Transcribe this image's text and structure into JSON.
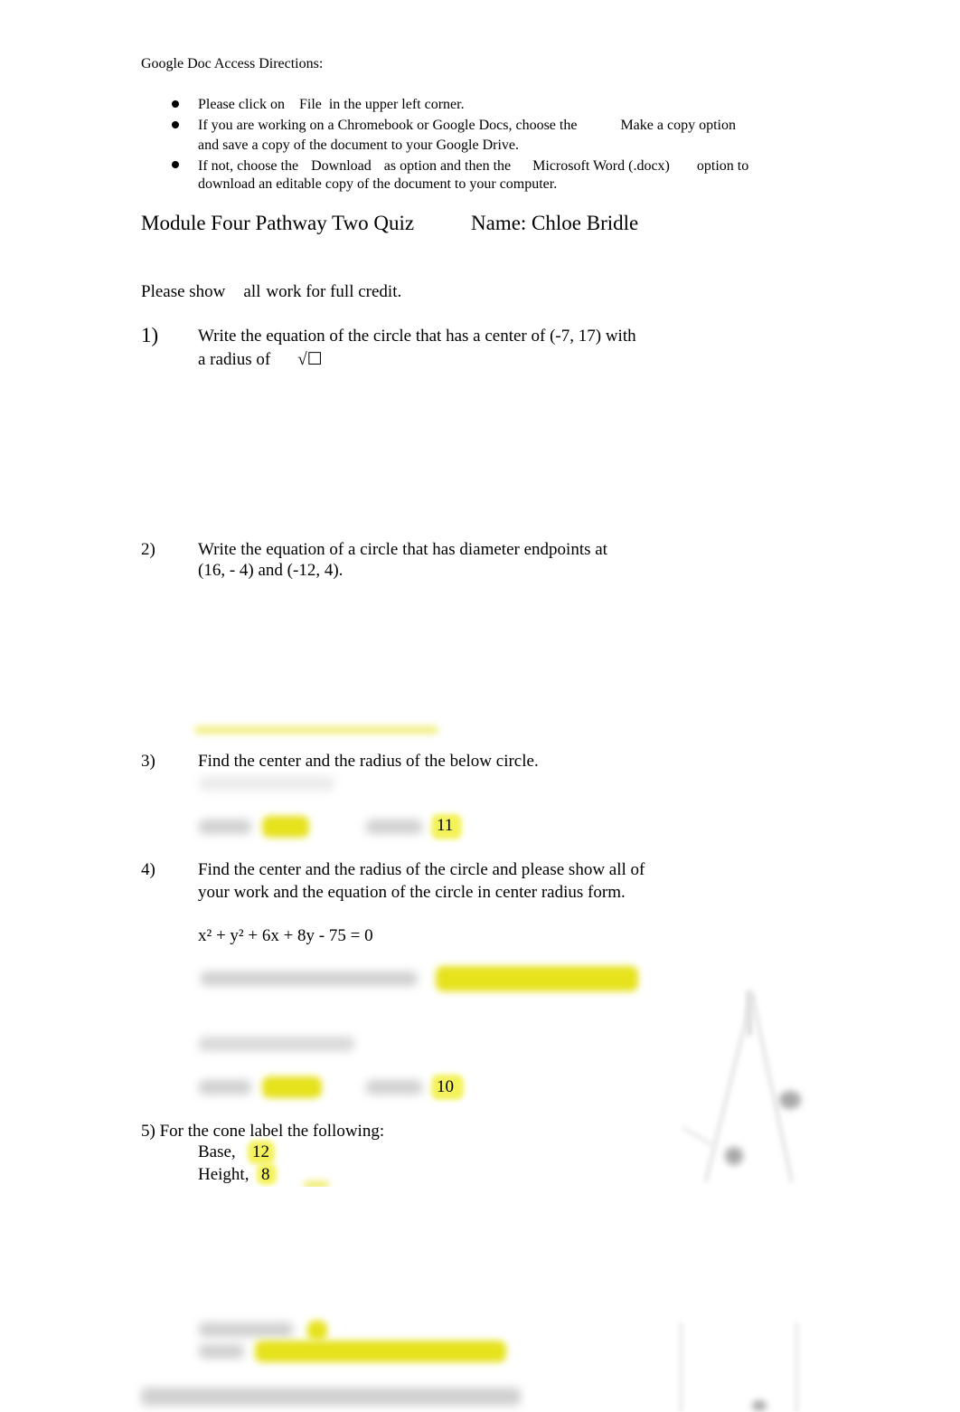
{
  "directions": {
    "title": "Google Doc Access Directions:",
    "bullets": [
      {
        "line1_parts": [
          "Please click on",
          "File",
          "in the upper left corner."
        ]
      },
      {
        "line1_parts": [
          "If you are working on a Chromebook or Google Docs, choose the",
          "Make a copy option"
        ],
        "line2": "and save a copy of the document to your Google Drive."
      },
      {
        "line1_parts": [
          "If not, choose the",
          "Download",
          "as option and then the",
          "Microsoft Word (.docx)",
          "option to"
        ],
        "line2": "download an editable copy of the document to your computer."
      }
    ]
  },
  "header": {
    "quiz_title": "Module Four Pathway Two Quiz",
    "name_label": "Name: Chloe Bridle"
  },
  "instructions": {
    "part1": "Please show",
    "part2": "all",
    "part3": "work for full credit."
  },
  "questions": [
    {
      "number": "1)",
      "line1": "Write the equation of the circle that has a center of (-7, 17) with",
      "line2": "a radius of",
      "radical": "√☐"
    },
    {
      "number": "2)",
      "line1": "Write the equation of a circle that has diameter endpoints at",
      "line2": "(16, - 4) and (-12, 4)."
    },
    {
      "number": "3)",
      "line1": "Find the center and the radius of the below circle.",
      "answers": {
        "radius": "11"
      }
    },
    {
      "number": "4)",
      "line1": "Find the center and the radius of the circle and please show all of",
      "line2": "your work and the equation of the circle in center radius form.",
      "equation": "x² + y² + 6x + 8y - 75 = 0",
      "answers": {
        "radius": "10"
      }
    },
    {
      "number": "5)",
      "line1": "For the cone label the following:",
      "labels": [
        {
          "label": "Base,",
          "value": "12"
        },
        {
          "label": "Height,",
          "value": "8"
        }
      ]
    }
  ],
  "colors": {
    "highlight": "#f4f25a",
    "blurred_highlight": "#e6e21c",
    "blurred_text": "#c8c8c8"
  }
}
